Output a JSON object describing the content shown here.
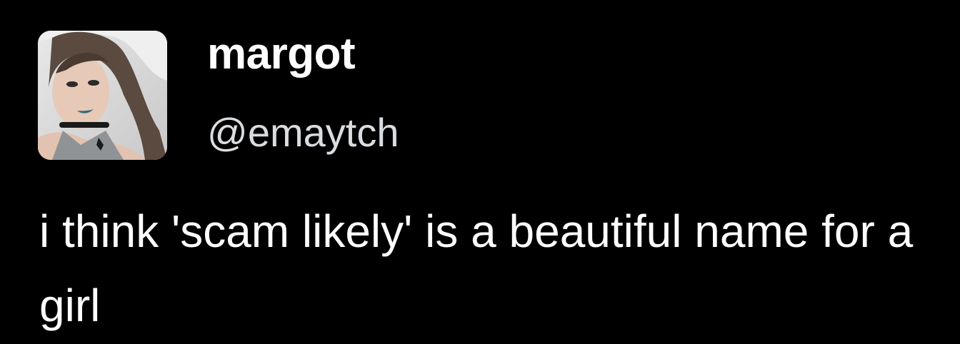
{
  "tweet": {
    "author": {
      "display_name": "margot",
      "handle": "@emaytch",
      "avatar_icon": "profile-photo"
    },
    "text": "i think 'scam likely' is a beautiful name for a girl"
  },
  "colors": {
    "background": "#000000",
    "text": "#ffffff",
    "handle": "#d9dde1"
  }
}
